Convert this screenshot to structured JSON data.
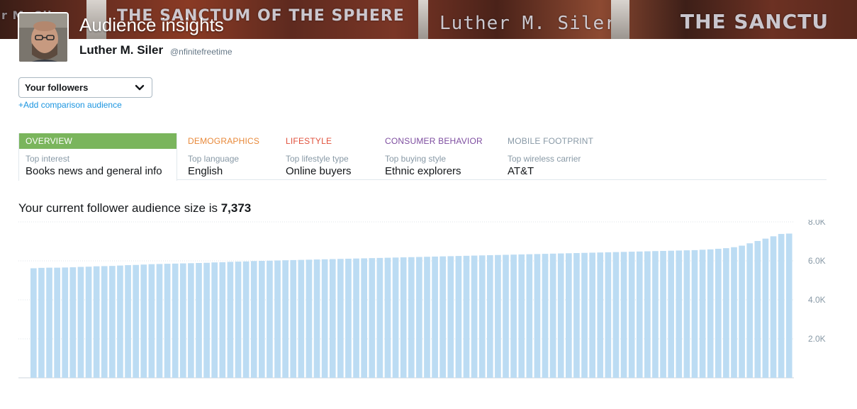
{
  "header": {
    "title": "Audience insights",
    "user_name": "Luther M. Siler",
    "user_handle": "@nfinitefreetime",
    "banner_text": [
      "THE SANCTUM OF THE SPHERE",
      "Luther M. Siler",
      "THE SANCTU",
      "r M. Sil"
    ]
  },
  "audience": {
    "selected": "Your followers",
    "add_comparison": "+Add comparison audience"
  },
  "tabs": [
    {
      "label": "OVERVIEW",
      "sub": "Top interest",
      "value": "Books news and general info",
      "color": "#7ab55c"
    },
    {
      "label": "DEMOGRAPHICS",
      "sub": "Top language",
      "value": "English",
      "color": "#e8893a"
    },
    {
      "label": "LIFESTYLE",
      "sub": "Top lifestyle type",
      "value": "Online buyers",
      "color": "#e0523d"
    },
    {
      "label": "CONSUMER BEHAVIOR",
      "sub": "Top buying style",
      "value": "Ethnic explorers",
      "color": "#7e4ea0"
    },
    {
      "label": "MOBILE FOOTPRINT",
      "sub": "Top wireless carrier",
      "value": "AT&T",
      "color": "#8899a6"
    }
  ],
  "summary": {
    "prefix": "Your current follower audience size is ",
    "count": "7,373"
  },
  "chart_data": {
    "type": "bar",
    "ylim": [
      0,
      8000
    ],
    "yticks": [
      "2.0K",
      "4.0K",
      "6.0K",
      "8.0K"
    ],
    "ytick_values": [
      2000,
      4000,
      6000,
      8000
    ],
    "grid": true,
    "bar_color": "#bcdcf3",
    "values": [
      5620,
      5640,
      5650,
      5650,
      5660,
      5670,
      5690,
      5700,
      5720,
      5730,
      5740,
      5760,
      5780,
      5790,
      5810,
      5830,
      5840,
      5850,
      5860,
      5870,
      5880,
      5890,
      5900,
      5920,
      5930,
      5950,
      5960,
      5970,
      5990,
      6000,
      6010,
      6020,
      6030,
      6040,
      6050,
      6060,
      6070,
      6080,
      6090,
      6100,
      6110,
      6120,
      6130,
      6140,
      6150,
      6160,
      6170,
      6180,
      6190,
      6200,
      6210,
      6220,
      6230,
      6240,
      6250,
      6260,
      6270,
      6280,
      6290,
      6300,
      6310,
      6320,
      6330,
      6340,
      6350,
      6360,
      6370,
      6380,
      6390,
      6400,
      6410,
      6420,
      6430,
      6440,
      6450,
      6460,
      6470,
      6480,
      6490,
      6500,
      6510,
      6520,
      6530,
      6540,
      6550,
      6570,
      6590,
      6620,
      6650,
      6700,
      6780,
      6900,
      7020,
      7140,
      7260,
      7380,
      7400
    ]
  }
}
